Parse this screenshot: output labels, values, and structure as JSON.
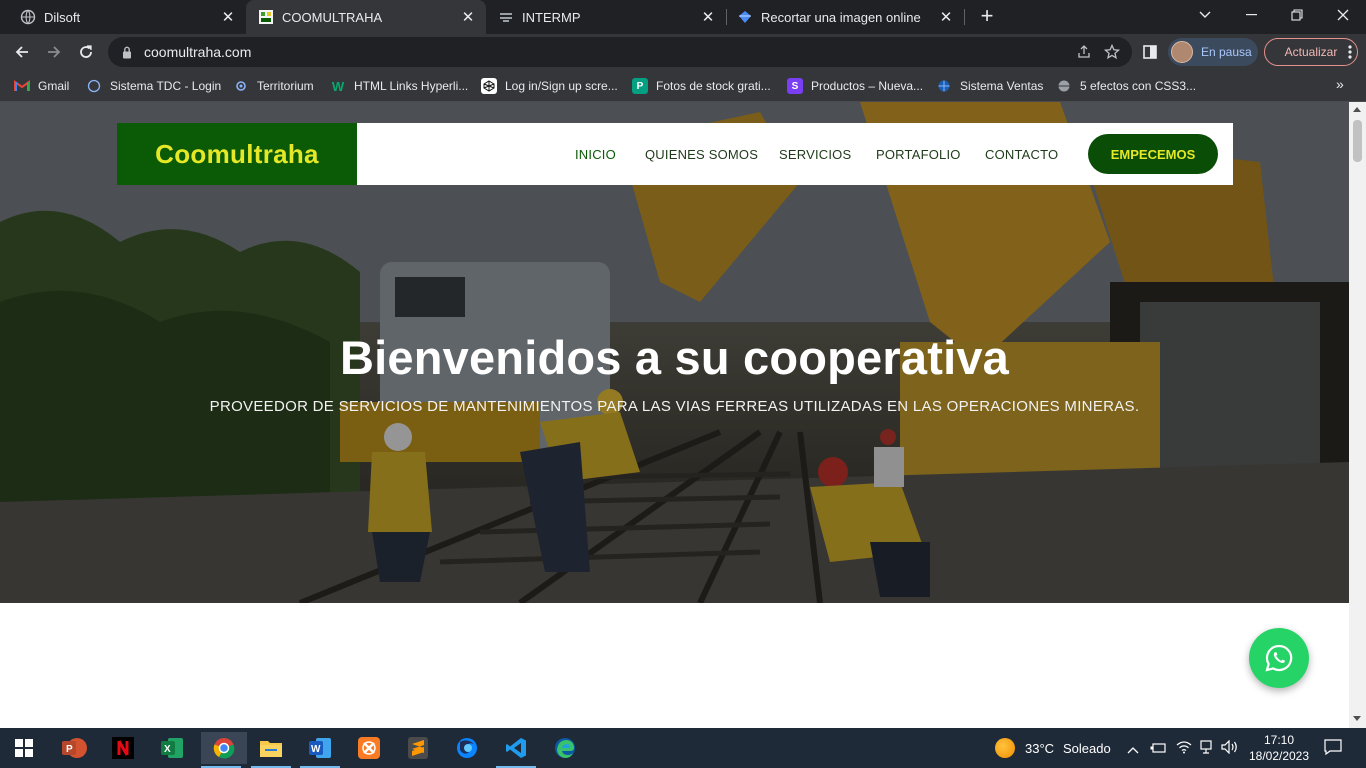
{
  "browser": {
    "tabs": [
      {
        "title": "Dilsoft",
        "active": false
      },
      {
        "title": "COOMULTRAHA",
        "active": true
      },
      {
        "title": "INTERMP",
        "active": false
      },
      {
        "title": "Recortar una imagen online",
        "active": false
      }
    ],
    "url": "coomultraha.com",
    "profile_label": "En pausa",
    "update_label": "Actualizar"
  },
  "bookmarks": [
    {
      "label": "Gmail",
      "icon": "gmail-icon"
    },
    {
      "label": "Sistema TDC - Login",
      "icon": "globe-icon"
    },
    {
      "label": "Territorium",
      "icon": "territorium-icon"
    },
    {
      "label": "HTML Links Hyperli...",
      "icon": "w3schools-icon"
    },
    {
      "label": "Log in/Sign up scre...",
      "icon": "codepen-icon"
    },
    {
      "label": "Fotos de stock grati...",
      "icon": "pexels-icon"
    },
    {
      "label": "Productos – Nueva...",
      "icon": "store-icon"
    },
    {
      "label": "Sistema Ventas",
      "icon": "globe-icon"
    },
    {
      "label": "5 efectos con CSS3...",
      "icon": "globe-icon"
    }
  ],
  "site": {
    "brand": "Coomultraha",
    "nav": {
      "inicio": "INICIO",
      "quienes": "QUIENES SOMOS",
      "servicios": "SERVICIOS",
      "portafolio": "PORTAFOLIO",
      "contacto": "CONTACTO",
      "cta": "EMPECEMOS"
    },
    "hero": {
      "title": "Bienvenidos a su cooperativa",
      "subtitle": "PROVEEDOR DE SERVICIOS DE MANTENIMIENTOS PARA LAS VIAS FERREAS UTILIZADAS EN LAS OPERACIONES MINERAS."
    }
  },
  "taskbar": {
    "apps": [
      "start-icon",
      "powerpoint-icon",
      "netflix-icon",
      "excel-icon",
      "chrome-icon",
      "file-explorer-icon",
      "word-icon",
      "xampp-icon",
      "sublime-text-icon",
      "firefox-dev-icon",
      "vscode-icon",
      "edge-icon"
    ],
    "weather_temp": "33°C",
    "weather_text": "Soleado",
    "time": "17:10",
    "date": "18/02/2023"
  },
  "colors": {
    "brand_green": "#0a5a06",
    "brand_yellow": "#e4e827",
    "whatsapp_green": "#25d366"
  }
}
